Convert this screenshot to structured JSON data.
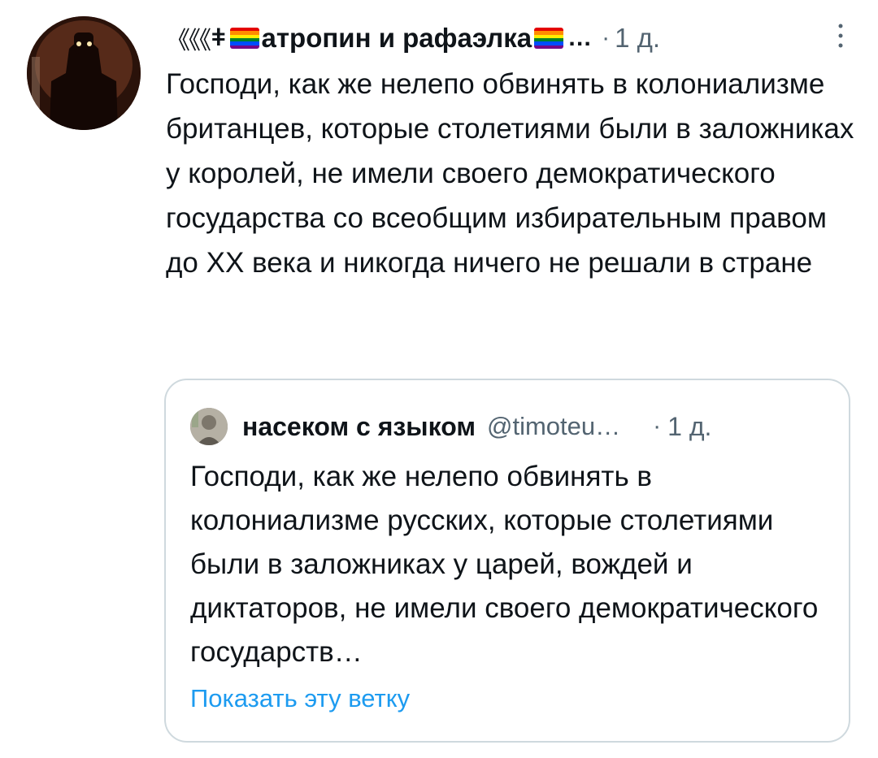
{
  "tweet": {
    "author": {
      "prefix_marks": "《《《",
      "dagger": "ǂ",
      "name": "атропин и рафаэлка",
      "ellipsis": "…",
      "avatar_icon": "robot-silhouette-avatar"
    },
    "separator": "·",
    "time": "1 д.",
    "more_icon": "vertical-dots-icon",
    "text": "Господи, как же нелепо обвинять в колониализме британцев, которые столетиями были в заложниках у королей, не имели своего демократического государства со всеобщим избирательным правом до XX века и никогда ничего не решали в стране",
    "flag_colors": [
      "#e40303",
      "#ff8c00",
      "#ffed00",
      "#008026",
      "#004dff",
      "#750787"
    ]
  },
  "quoted": {
    "author_name": "насеком с языком",
    "handle": "@timoteu…",
    "separator": "·",
    "time": "1 д.",
    "text": "Господи, как же нелепо обвинять в колониализме русских, которые столетиями были в заложниках у царей, вождей и диктаторов, не имели своего демократического государств…",
    "show_thread": "Показать эту ветку"
  },
  "colors": {
    "text": "#0f1419",
    "secondary": "#536471",
    "link": "#1d9bf0",
    "border": "#cfd9de"
  }
}
